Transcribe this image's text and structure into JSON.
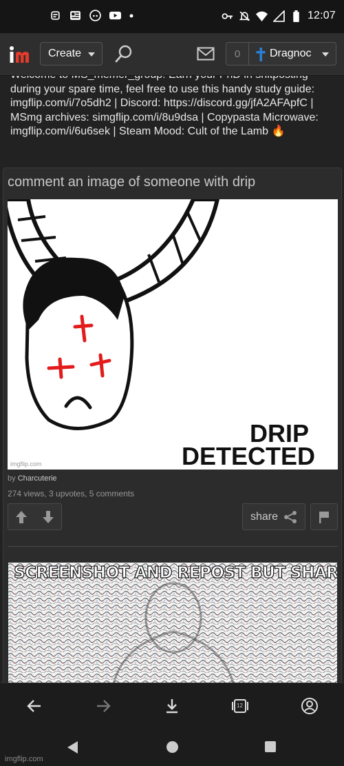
{
  "status_bar": {
    "time": "12:07",
    "left_icons": [
      "news-icon",
      "newspaper-icon",
      "discord-icon",
      "youtube-icon",
      "dot-icon"
    ],
    "right_icons": [
      "key-icon",
      "mute-icon",
      "wifi-icon",
      "signal-icon",
      "battery-icon"
    ]
  },
  "header": {
    "logo_text": "im",
    "create_label": "Create",
    "notification_count": "0",
    "username": "Dragnoc"
  },
  "stream": {
    "description_clipped": "Welcome to MS_memer_group! Earn your PhD in shitposting",
    "description": "during your spare time, feel free to use this handy study guide: imgflip.com/i/7o5dh2 | Discord: https://discord.gg/jfA2AFApfC | MSmg archives: simgflip.com/i/8u9dsa | Copypasta Microwave: imgflip.com/i/6u6sek | Steam Mood: Cult of the Lamb 🔥"
  },
  "post": {
    "title": "comment an image of someone with drip",
    "meme_caption_line1": "DRIP",
    "meme_caption_line2": "DETECTED",
    "watermark": "imgflip.com",
    "by_prefix": "by",
    "author": "Charcuterie",
    "stats": "274 views, 3 upvotes, 5 comments",
    "share_label": "share"
  },
  "comment": {
    "image_text": "SCREENSHOT AND REPOST BUT SHARPEN"
  },
  "browser_toolbar": {
    "tab_count": "12"
  },
  "android_nav": {
    "domain": "imgflip.com"
  },
  "colors": {
    "logo_accent": "#e23a2b",
    "cross_blue": "#2a7fd4",
    "background": "#222222"
  }
}
